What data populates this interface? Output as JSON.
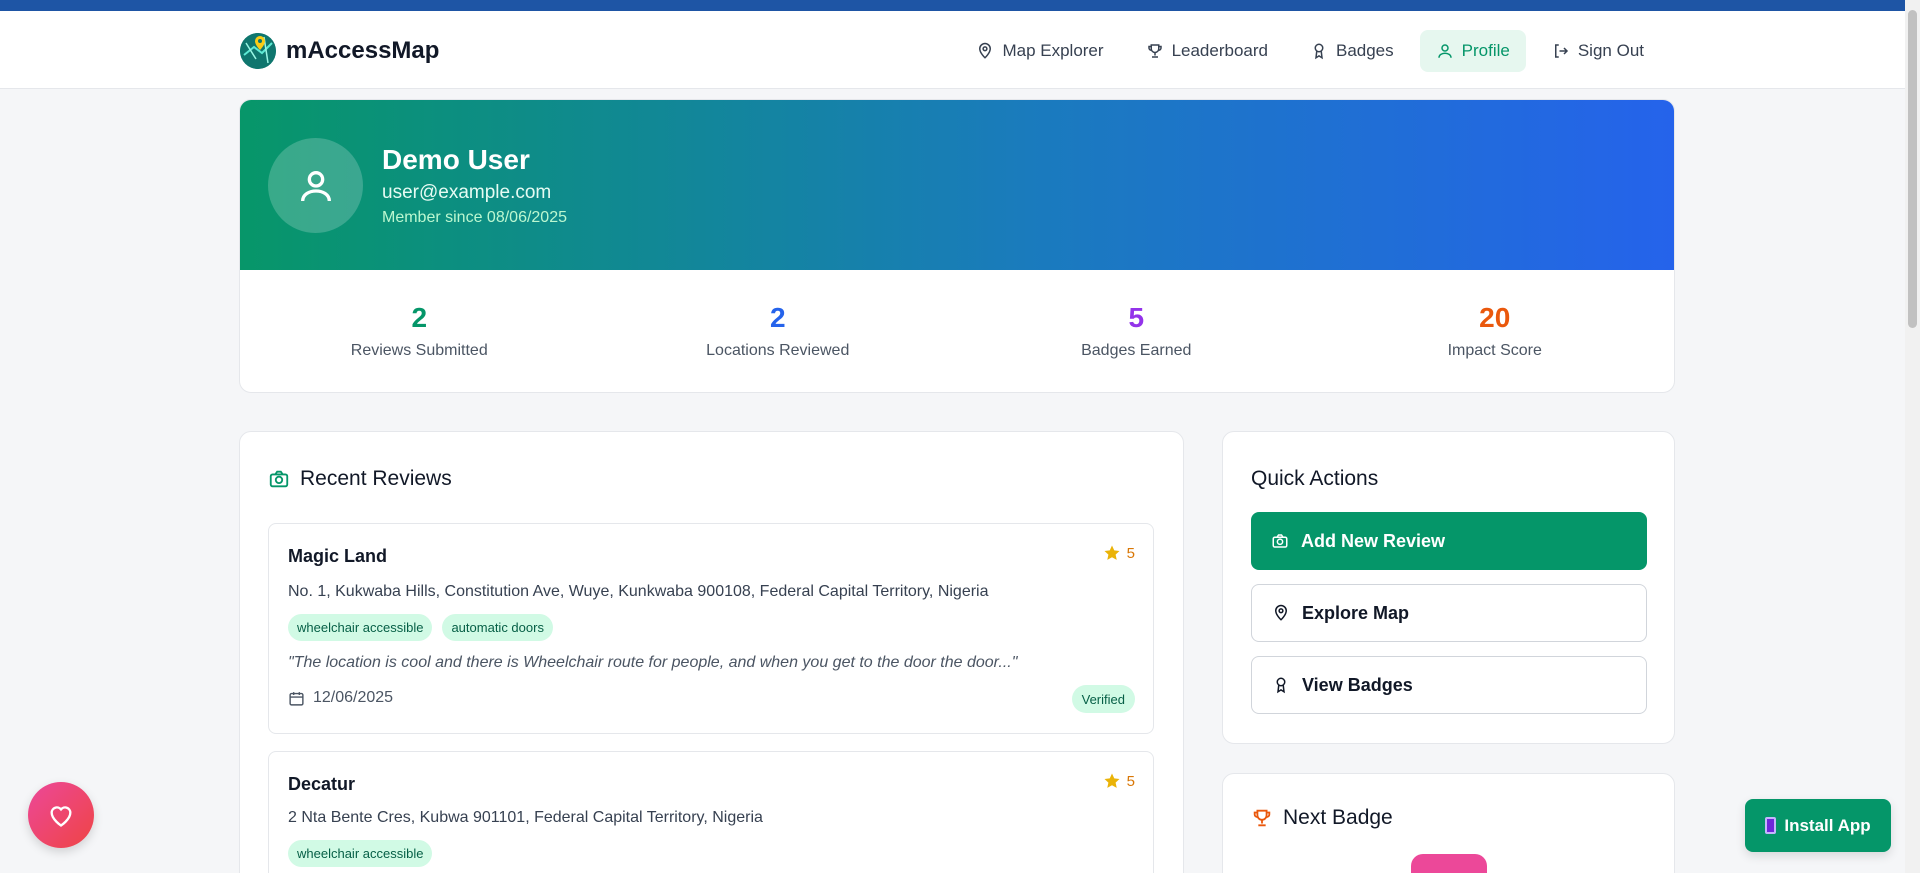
{
  "app": {
    "name": "mAccessMap"
  },
  "nav": {
    "items": [
      {
        "label": "Map Explorer",
        "icon": "map-pin-icon"
      },
      {
        "label": "Leaderboard",
        "icon": "trophy-icon"
      },
      {
        "label": "Badges",
        "icon": "award-icon"
      },
      {
        "label": "Profile",
        "icon": "user-icon",
        "active": true
      },
      {
        "label": "Sign Out",
        "icon": "sign-out-icon"
      }
    ]
  },
  "profile": {
    "name": "Demo User",
    "email": "user@example.com",
    "member_since": "Member since 08/06/2025"
  },
  "stats": [
    {
      "value": "2",
      "label": "Reviews Submitted",
      "color": "#059669"
    },
    {
      "value": "2",
      "label": "Locations Reviewed",
      "color": "#2563eb"
    },
    {
      "value": "5",
      "label": "Badges Earned",
      "color": "#9333ea"
    },
    {
      "value": "20",
      "label": "Impact Score",
      "color": "#ea580c"
    }
  ],
  "recent_reviews": {
    "title": "Recent Reviews",
    "items": [
      {
        "name": "Magic Land",
        "rating": "5",
        "address": "No. 1, Kukwaba Hills, Constitution Ave, Wuye, Kunkwaba 900108, Federal Capital Territory, Nigeria",
        "tags": [
          "wheelchair accessible",
          "automatic doors"
        ],
        "quote": "\"The location is cool and there is Wheelchair route for people, and when you get to the door the door...\"",
        "date": "12/06/2025",
        "status": "Verified"
      },
      {
        "name": "Decatur",
        "rating": "5",
        "address": "2 Nta Bente Cres, Kubwa 901101, Federal Capital Territory, Nigeria",
        "tags": [
          "wheelchair accessible"
        ]
      }
    ]
  },
  "quick_actions": {
    "title": "Quick Actions",
    "add_review": "Add New Review",
    "explore_map": "Explore Map",
    "view_badges": "View Badges"
  },
  "next_badge": {
    "title": "Next Badge"
  },
  "install_app": {
    "label": "Install App"
  },
  "colors": {
    "primary": "#059669",
    "accent_blue": "#2563eb",
    "star": "#d97706"
  }
}
